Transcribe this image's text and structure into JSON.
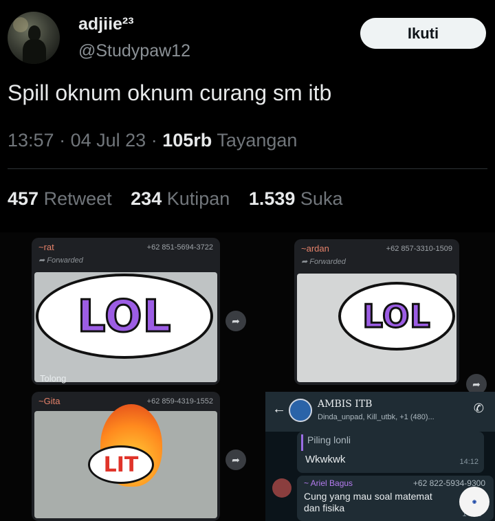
{
  "header": {
    "display_name": "adjiie²³",
    "handle": "@Studypaw12",
    "follow_label": "Ikuti"
  },
  "tweet": {
    "text": "Spill oknum oknum curang sm itb",
    "time": "13:57",
    "date": "04 Jul 23",
    "views_count": "105rb",
    "views_label": "Tayangan",
    "separator": "·"
  },
  "stats": {
    "retweets_count": "457",
    "retweets_label": "Retweet",
    "quotes_count": "234",
    "quotes_label": "Kutipan",
    "likes_count": "1.539",
    "likes_label": "Suka"
  },
  "media": {
    "card1": {
      "sender": "~rat",
      "phone": "+62 851-5694-3722",
      "forwarded": "Forwarded",
      "sticker": "LOL",
      "caption": "Tolong"
    },
    "card2": {
      "sender": "~ardan",
      "phone": "+62 857-3310-1509",
      "forwarded": "Forwarded",
      "sticker": "LOL"
    },
    "card3": {
      "sender": "~Gita",
      "phone": "+62 859-4319-1552",
      "sticker": "LIT"
    },
    "whatsapp": {
      "group_name": "AMBIS ITB",
      "members": "Dinda_unpad, Kill_utbk, +1 (480)...",
      "quoted_name": "Piling lonli",
      "message_text": "Wkwkwk",
      "message_time": "14:12",
      "sender2": "~ Ariel Bagus",
      "phone2": "+62 822-5934-9300",
      "message2_line1": "Cung yang mau soal matemat",
      "message2_line2": "dan fisika",
      "message2_time": "14:12"
    }
  },
  "icons": {
    "back": "arrow-left-icon",
    "call": "call-add-icon",
    "share": "share-arrow-icon",
    "forward": "forward-arrow-icon"
  }
}
